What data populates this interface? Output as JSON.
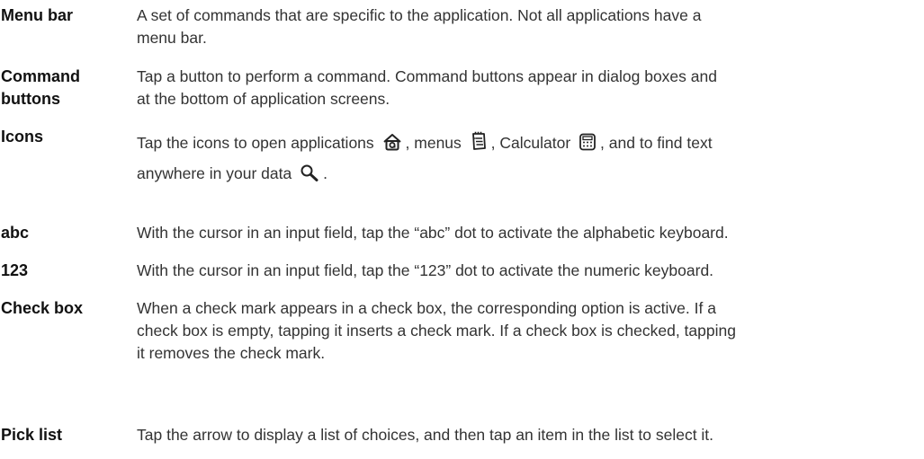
{
  "entries": [
    {
      "term": "Menu bar",
      "lines": [
        "A set of commands that are specific to the application. Not all applications have a",
        "menu bar."
      ]
    },
    {
      "term_lines": [
        "Command",
        "buttons"
      ],
      "lines": [
        "Tap a button to perform a command. Command buttons appear in dialog boxes and",
        "at the bottom of application screens."
      ]
    },
    {
      "term": "Icons",
      "parts": [
        "Tap the icons to open applications",
        ", menus",
        ", Calculator",
        ", and to find text",
        "anywhere in your data",
        "."
      ],
      "icon_names": [
        "home-icon",
        "menu-icon",
        "calculator-icon",
        "find-icon"
      ]
    },
    {
      "term": "abc",
      "lines": [
        "With the cursor in an input field, tap the “abc” dot to activate the alphabetic keyboard."
      ]
    },
    {
      "term": "123",
      "lines": [
        "With the cursor in an input field, tap the “123” dot to activate the numeric keyboard."
      ]
    },
    {
      "term": "Check box",
      "lines": [
        "When a check mark appears in a check box, the corresponding option is active. If a",
        "check box is empty, tapping it inserts a check mark. If a check box is checked, tapping",
        "it removes the check mark."
      ]
    },
    {
      "term": "Pick list",
      "lines": [
        "Tap the arrow to display a list of choices, and then tap an item in the list to select it."
      ]
    }
  ]
}
